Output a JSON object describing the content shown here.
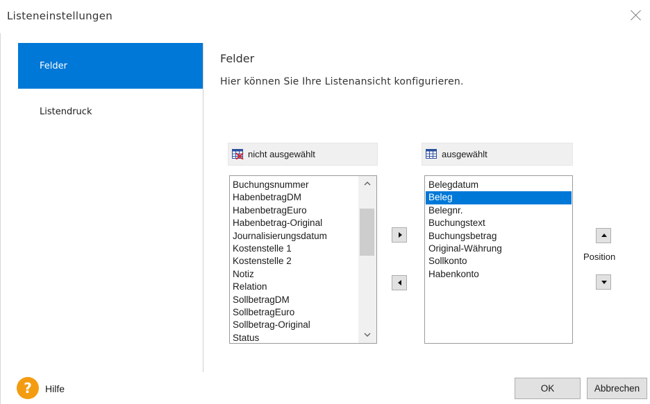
{
  "window": {
    "title": "Listeneinstellungen"
  },
  "sidebar": {
    "items": [
      {
        "label": "Felder",
        "selected": true
      },
      {
        "label": "Listendruck",
        "selected": false
      }
    ]
  },
  "main": {
    "title": "Felder",
    "description": "Hier können Sie Ihre Listenansicht konfigurieren.",
    "available": {
      "header": "nicht ausgewählt",
      "items": [
        "Buchungsnummer",
        "HabenbetragDM",
        "HabenbetragEuro",
        "Habenbetrag-Original",
        "Journalisierungsdatum",
        "Kostenstelle 1",
        "Kostenstelle 2",
        "Notiz",
        "Relation",
        "SollbetragDM",
        "SollbetragEuro",
        "Sollbetrag-Original",
        "Status"
      ]
    },
    "selected": {
      "header": "ausgewählt",
      "items": [
        "Belegdatum",
        "Beleg",
        "Belegnr.",
        "Buchungstext",
        "Buchungsbetrag",
        "Original-Währung",
        "Sollkonto",
        "Habenkonto"
      ],
      "highlighted_item": "Beleg"
    },
    "position_label": "Position"
  },
  "footer": {
    "help_label": "Hilfe",
    "ok_label": "OK",
    "cancel_label": "Abbrechen"
  },
  "colors": {
    "accent": "#0078d7",
    "help_icon": "#f39c12"
  },
  "icons": [
    "close-icon",
    "table-remove-icon",
    "table-icon",
    "arrow-right-icon",
    "arrow-left-icon",
    "arrow-up-icon",
    "arrow-down-icon",
    "help-icon"
  ]
}
